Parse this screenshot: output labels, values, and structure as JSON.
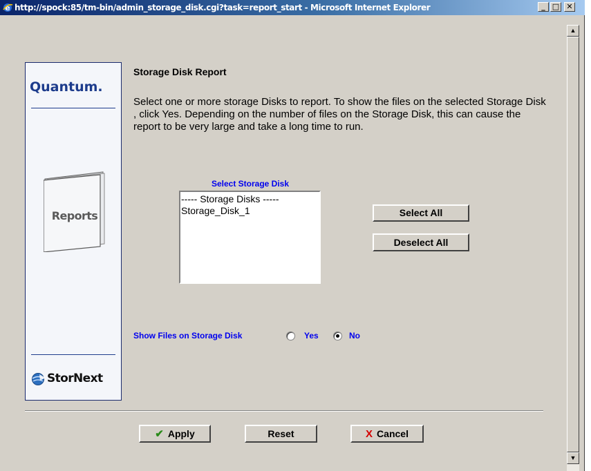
{
  "window": {
    "title": "http://spock:85/tm-bin/admin_storage_disk.cgi?task=report_start - Microsoft Internet Explorer",
    "minimize": "_",
    "maximize": "□",
    "close": "✕"
  },
  "scrollbar": {
    "up": "▲",
    "down": "▼"
  },
  "sidebar": {
    "logo": "Quantum.",
    "section_label": "Reports",
    "brand": "StorNext"
  },
  "report": {
    "heading": "Storage Disk Report",
    "description": "Select one or more storage Disks to report. To show the files on the selected Storage Disk , click Yes. Depending on the number of files on the Storage Disk, this can cause the report to be very large and take a long time to run.",
    "select_label": "Select Storage Disk",
    "list_options": [
      "----- Storage Disks -----",
      "Storage_Disk_1"
    ],
    "select_all_label": "Select All",
    "deselect_all_label": "Deselect All",
    "show_files_label": "Show Files on Storage Disk",
    "radio_yes_label": "Yes",
    "radio_no_label": "No",
    "show_files_selected": "No"
  },
  "footer": {
    "apply_label": "Apply",
    "reset_label": "Reset",
    "cancel_label": "Cancel",
    "apply_icon": "check-icon",
    "cancel_icon": "x-icon"
  }
}
